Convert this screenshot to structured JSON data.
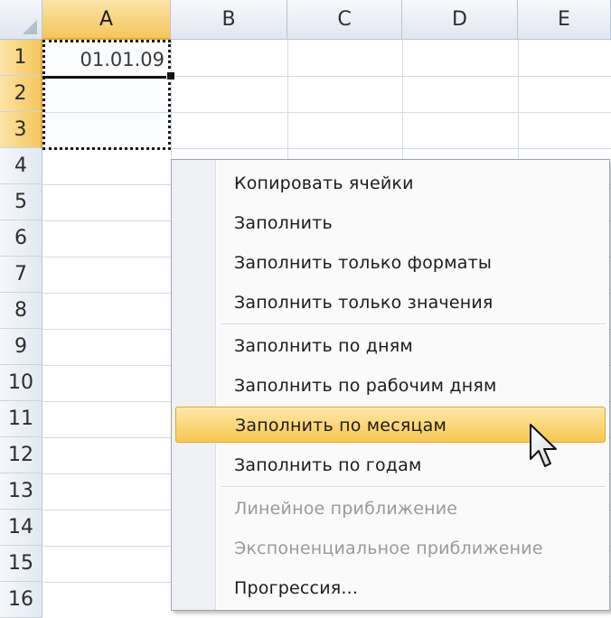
{
  "columns": [
    "A",
    "B",
    "C",
    "D",
    "E"
  ],
  "rows": [
    "1",
    "2",
    "3",
    "4",
    "5",
    "6",
    "7",
    "8",
    "9",
    "10",
    "11",
    "12",
    "13",
    "14",
    "15",
    "16"
  ],
  "cells": {
    "A1": "01.01.09"
  },
  "selection": {
    "range": "A1:A3",
    "selected_column": "A",
    "selected_rows": [
      "1",
      "2",
      "3"
    ]
  },
  "context_menu": {
    "items": [
      {
        "label": "Копировать ячейки",
        "enabled": true
      },
      {
        "label": "Заполнить",
        "enabled": true
      },
      {
        "label": "Заполнить только форматы",
        "enabled": true
      },
      {
        "label": "Заполнить только значения",
        "enabled": true
      },
      {
        "label": "Заполнить по дням",
        "enabled": true
      },
      {
        "label": "Заполнить по рабочим дням",
        "enabled": true
      },
      {
        "label": "Заполнить по месяцам",
        "enabled": true,
        "highlighted": true
      },
      {
        "label": "Заполнить по годам",
        "enabled": true
      },
      {
        "label": "Линейное приближение",
        "enabled": false
      },
      {
        "label": "Экспоненциальное приближение",
        "enabled": false
      },
      {
        "label": "Прогрессия...",
        "enabled": true
      }
    ]
  },
  "colors": {
    "highlight": "#f7c74e",
    "header_selected": "#f6c65c",
    "grid": "#d4dbe4",
    "disabled_text": "#9a9a9a"
  },
  "icons": {
    "cursor": "mouse-pointer-icon",
    "select_all": "select-all-triangle-icon"
  }
}
